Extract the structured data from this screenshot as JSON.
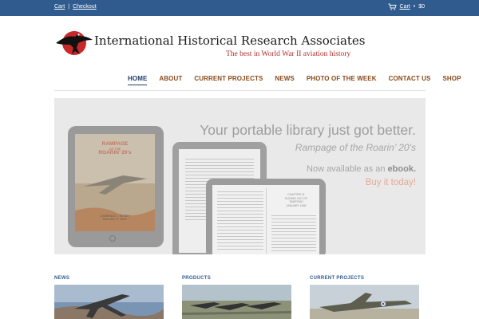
{
  "topbar": {
    "cart_link": "Cart",
    "separator": "|",
    "checkout_link": "Checkout",
    "cart_right": "Cart",
    "cart_total": "$0",
    "bar_color": "#2f5b8f"
  },
  "header": {
    "site_title": "International Historical Research Associates",
    "tagline": "The best in World War II aviation history"
  },
  "nav": {
    "items": [
      "HOME",
      "ABOUT",
      "CURRENT PROJECTS",
      "NEWS",
      "PHOTO OF THE WEEK",
      "CONTACT US",
      "SHOP"
    ],
    "active": "HOME"
  },
  "hero": {
    "headline": "Your portable library just got better.",
    "subline": "Rampage of the Roarin’ 20’s",
    "avail_prefix": "Now available as an ",
    "avail_bold": "ebook.",
    "buy": "Buy it today!",
    "book": {
      "title_line1": "RAMPAGE",
      "title_line2": "OF THE",
      "title_line3": "ROARIN’ 20’s",
      "author_line1": "LAWRENCE J. HICKEY",
      "author_line2": "MICHAEL R. GEAT"
    },
    "chapter": {
      "line1": "CHAPTER 11",
      "line2": "SLIDING OUT OF",
      "line3": "TAMPONG",
      "line4": "JANUARY 1945"
    }
  },
  "columns": [
    {
      "label": "NEWS"
    },
    {
      "label": "PRODUCTS"
    },
    {
      "label": "CURRENT PROJECTS"
    }
  ]
}
